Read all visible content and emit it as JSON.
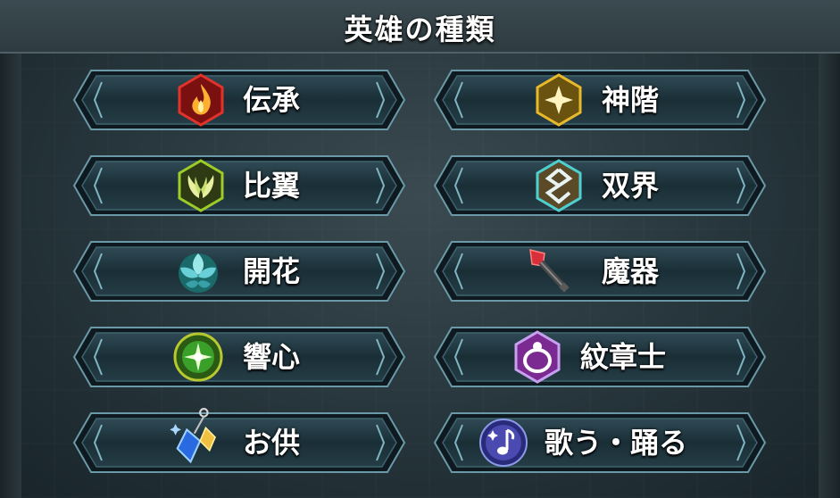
{
  "header": {
    "title": "英雄の種類"
  },
  "buttons": [
    {
      "label": "伝承",
      "icon": "legendary-flame-icon",
      "color": "#e0332a"
    },
    {
      "label": "神階",
      "icon": "mythic-star-icon",
      "color": "#e8b92a"
    },
    {
      "label": "比翼",
      "icon": "duo-wings-icon",
      "color": "#9ccc2a"
    },
    {
      "label": "双界",
      "icon": "harmonized-icon",
      "color": "#4fd0d0"
    },
    {
      "label": "開花",
      "icon": "ascended-flower-icon",
      "color": "#5fd6e0"
    },
    {
      "label": "魔器",
      "icon": "rearmed-weapon-icon",
      "color": "#d8303a"
    },
    {
      "label": "響心",
      "icon": "attuned-orb-icon",
      "color": "#5fd84a"
    },
    {
      "label": "紋章士",
      "icon": "emblem-ring-icon",
      "color": "#b070e8"
    },
    {
      "label": "お供",
      "icon": "aide-crystal-icon",
      "color": "#3a9ae8"
    },
    {
      "label": "歌う・踊る",
      "icon": "sing-dance-note-icon",
      "color": "#7a6ae0"
    }
  ]
}
